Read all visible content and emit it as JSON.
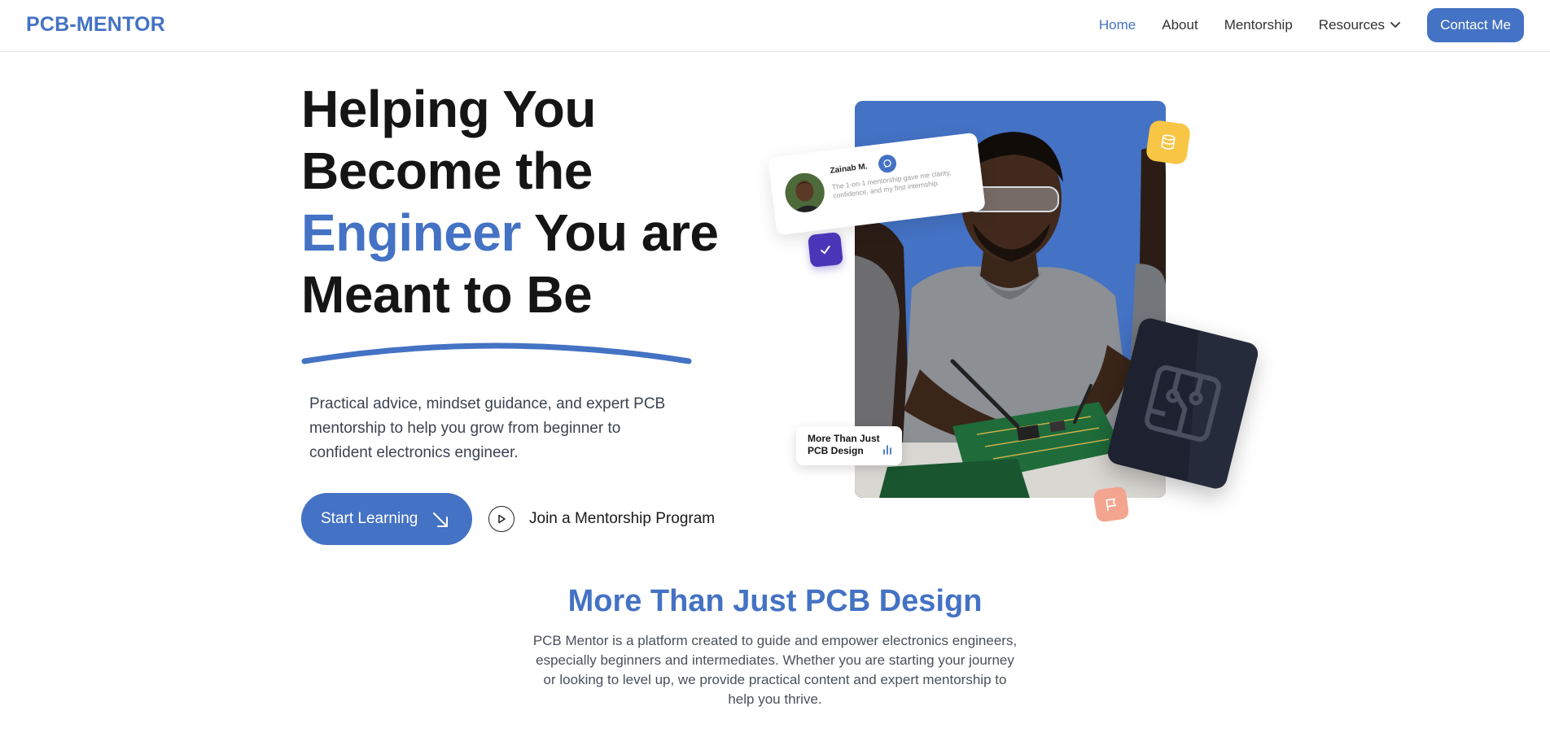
{
  "nav": {
    "logo": "PCB-MENTOR",
    "links": [
      "Home",
      "About",
      "Mentorship",
      "Resources"
    ],
    "active": "Home",
    "contact": "Contact Me"
  },
  "hero": {
    "title_line1": "Helping You",
    "title_line2": "Become the",
    "title_accent": "Engineer",
    "title_line3_rest": " You are",
    "title_line4": "Meant to Be",
    "description": "Practical advice, mindset guidance, and expert PCB mentorship to help you grow from beginner to confident electronics engineer.",
    "primary_cta": "Start Learning",
    "secondary_cta": "Join a Mentorship Program"
  },
  "testimonial": {
    "name": "Zainab M.",
    "quote": "The 1-on-1 mentorship gave me clarity, confidence, and my first internship."
  },
  "mini_card": {
    "text": "More Than Just PCB Design"
  },
  "section": {
    "title": "More Than Just PCB Design",
    "description": "PCB Mentor is a platform created to guide and empower electronics engineers, especially beginners and intermediates. Whether you are starting your journey or looking to level up, we provide practical content and expert mentorship to help you thrive."
  },
  "colors": {
    "accent": "#4472c4",
    "check_badge": "#4b35b8",
    "database_badge": "#f8c544",
    "flag_badge": "#f4a58f",
    "pcb_card": "#1d2130"
  },
  "icons": [
    "chevron-down-icon",
    "arrow-down-right-icon",
    "play-icon",
    "chat-bubble-icon",
    "check-icon",
    "database-icon",
    "flag-icon",
    "circuit-icon",
    "bar-chart-icon"
  ]
}
